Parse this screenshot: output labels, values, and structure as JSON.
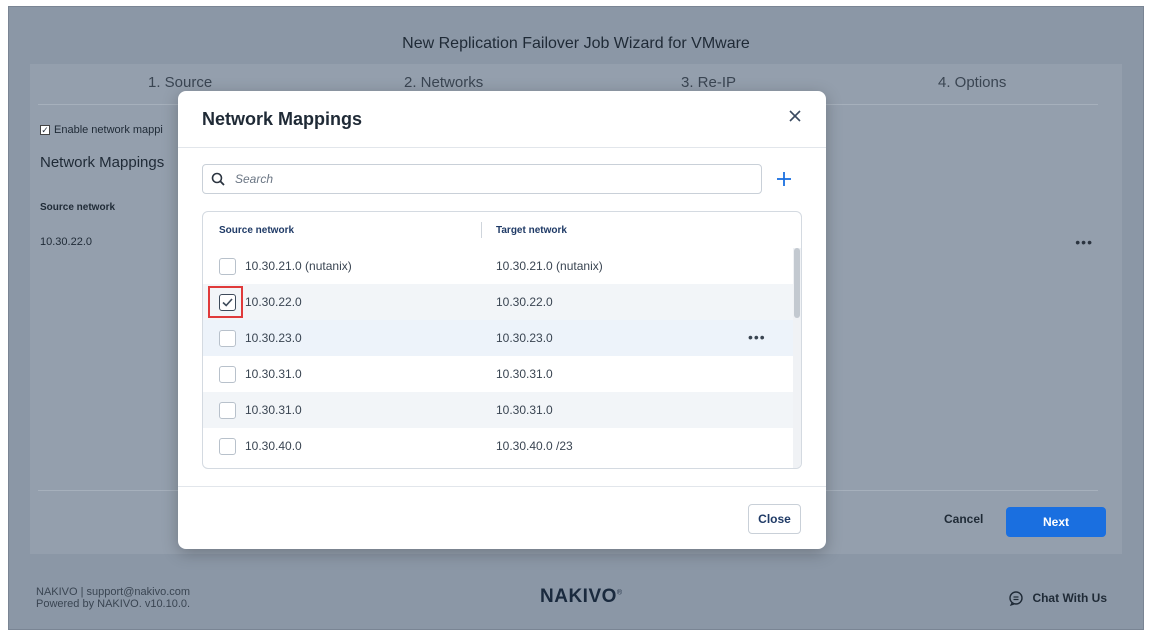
{
  "wizard": {
    "title": "New Replication Failover Job Wizard for VMware",
    "steps": [
      "1. Source",
      "2. Networks",
      "3. Re-IP",
      "4. Options"
    ],
    "enable_label": "Enable network mappi",
    "section_title": "Network Mappings",
    "column_source": "Source network",
    "mapping_value": "10.30.22.0",
    "cancel_label": "Cancel",
    "next_label": "Next"
  },
  "footer": {
    "contact": "NAKIVO | support@nakivo.com",
    "powered": "Powered by NAKIVO. v10.10.0.",
    "logo": "NAKIVO",
    "logo_mark": "®",
    "chat": "Chat With Us"
  },
  "modal": {
    "title": "Network Mappings",
    "search_placeholder": "Search",
    "col_source": "Source network",
    "col_target": "Target network",
    "rows": [
      {
        "source": "10.30.21.0 (nutanix)",
        "target": "10.30.21.0 (nutanix)",
        "checked": false
      },
      {
        "source": "10.30.22.0",
        "target": "10.30.22.0",
        "checked": true
      },
      {
        "source": "10.30.23.0",
        "target": "10.30.23.0",
        "checked": false
      },
      {
        "source": "10.30.31.0",
        "target": "10.30.31.0",
        "checked": false
      },
      {
        "source": "10.30.31.0",
        "target": "10.30.31.0",
        "checked": false
      },
      {
        "source": "10.30.40.0",
        "target": "10.30.40.0 /23",
        "checked": false
      }
    ],
    "close_label": "Close"
  },
  "colors": {
    "accent": "#1a6fe0",
    "highlight": "#e03a3a",
    "backdrop": "#8b97a6"
  }
}
